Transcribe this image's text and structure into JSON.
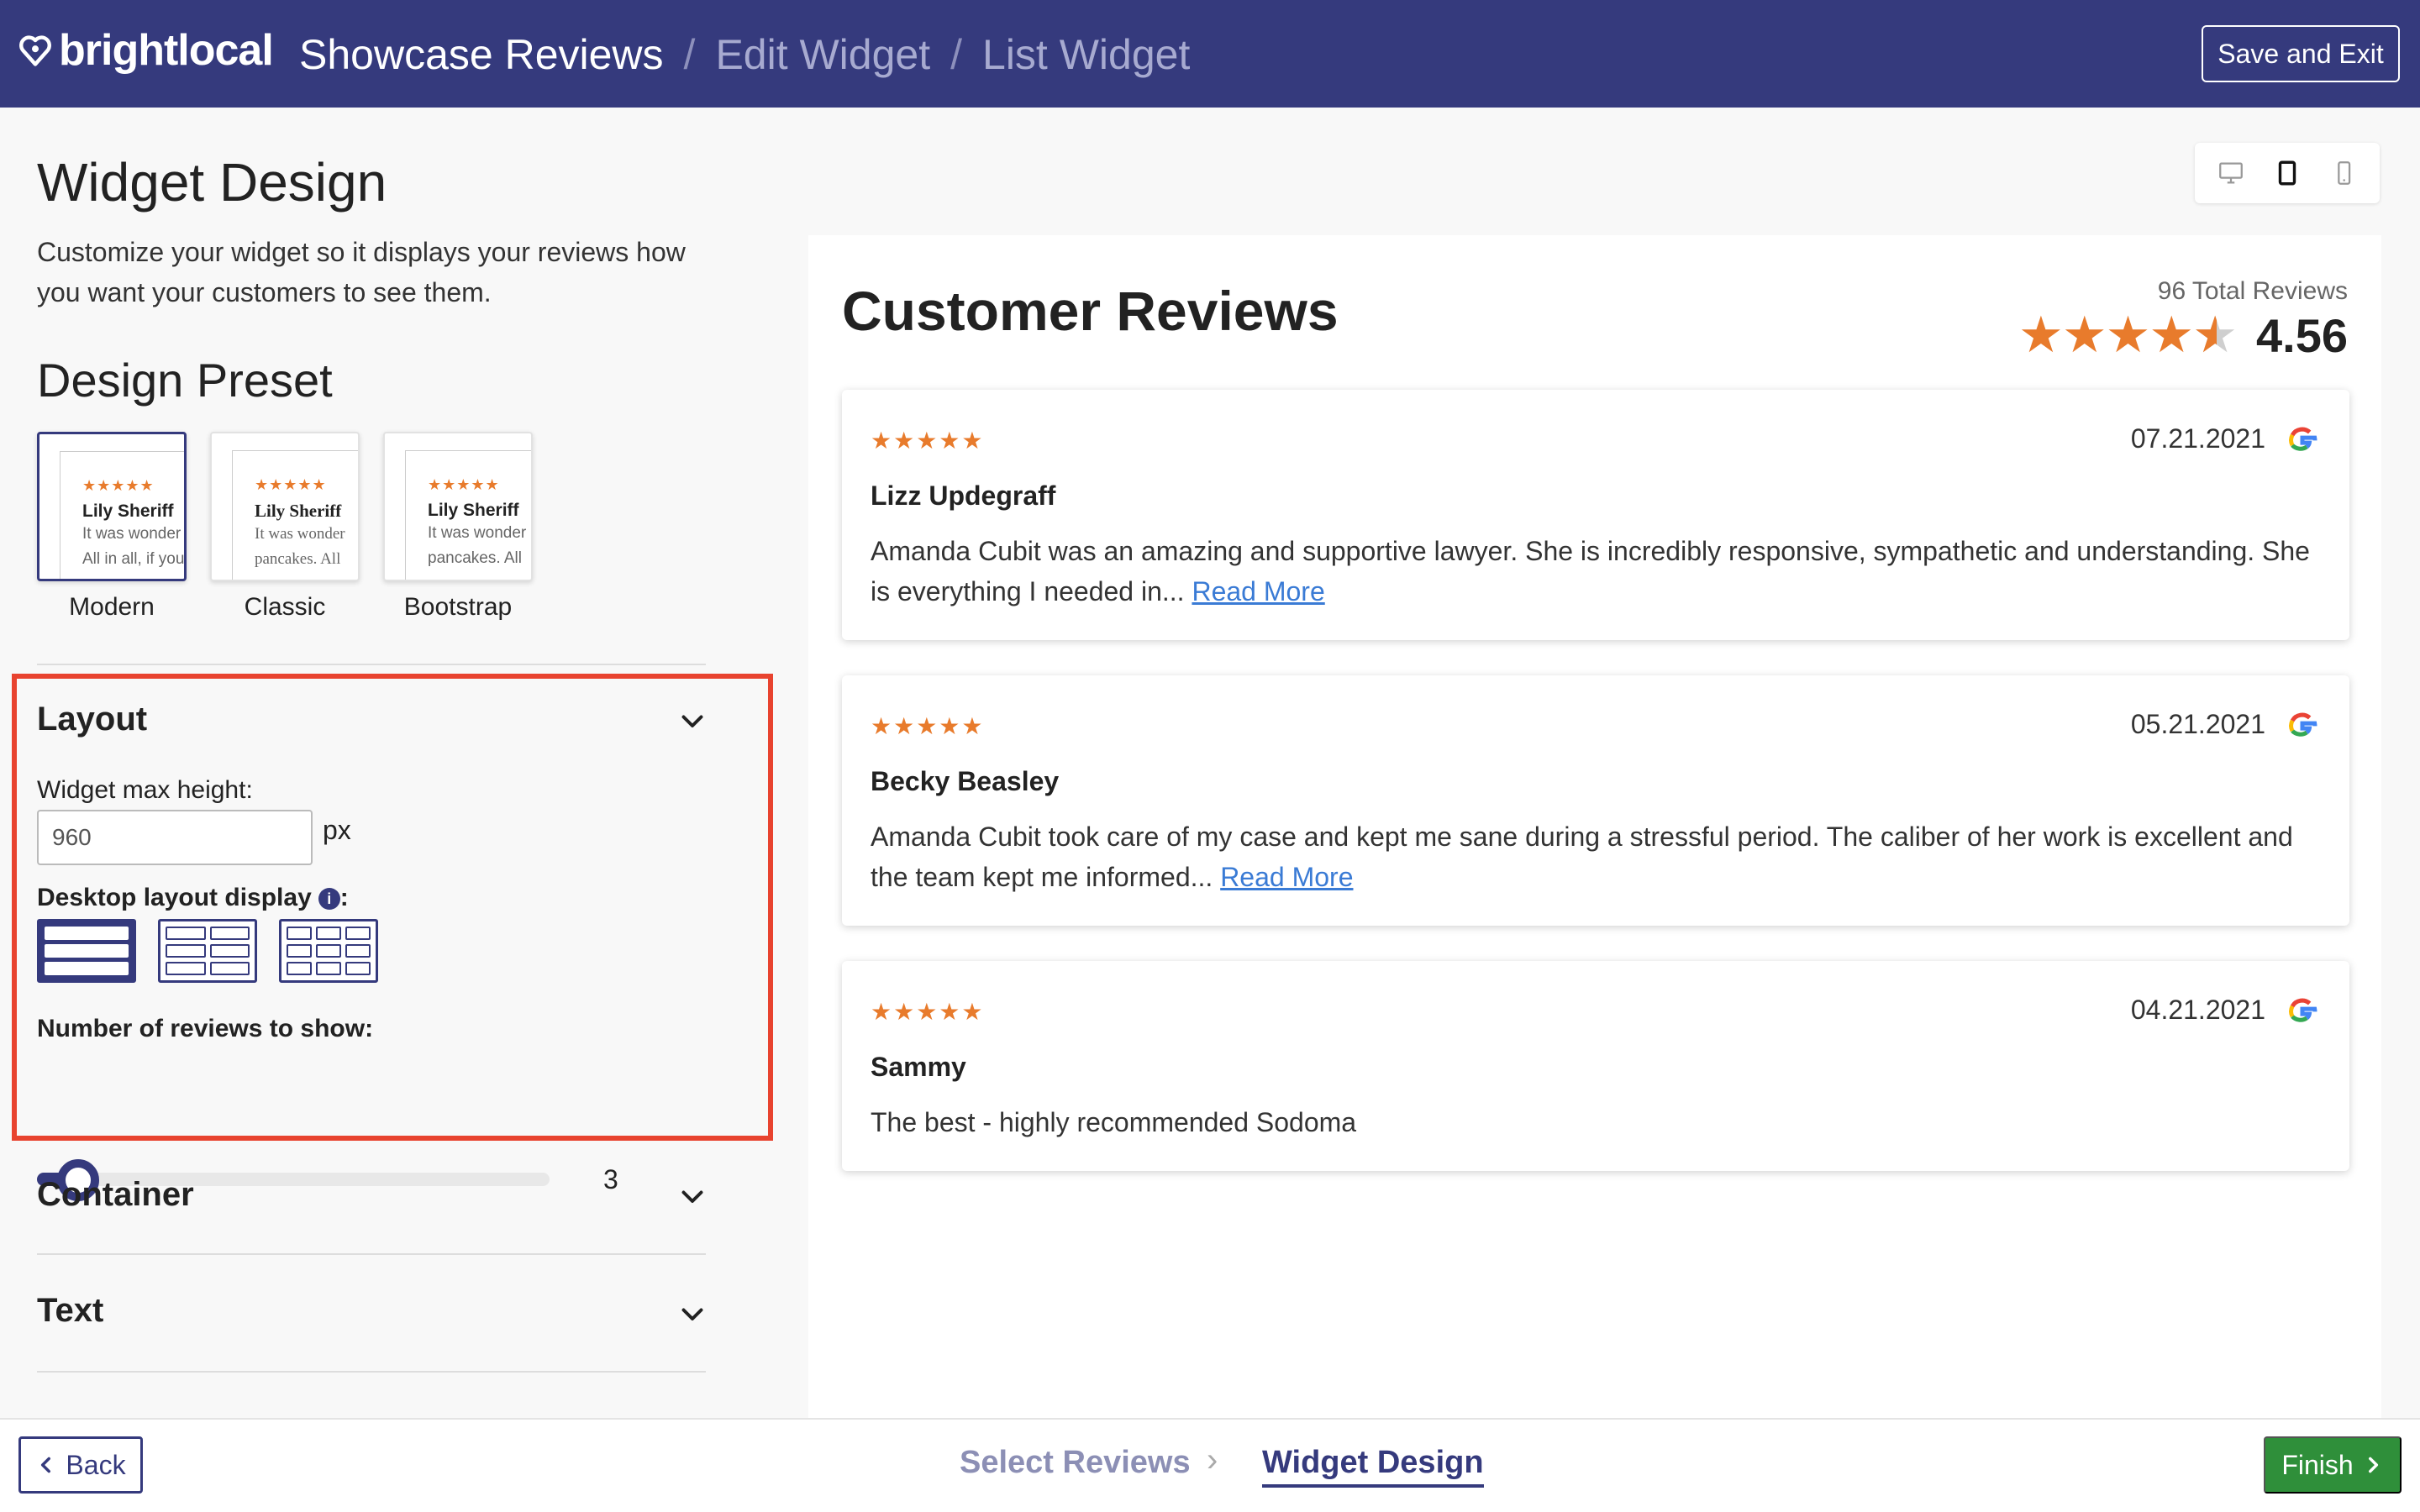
{
  "header": {
    "logo_text": "brightlocal",
    "crumb_1": "Showcase Reviews",
    "crumb_2": "Edit Widget",
    "crumb_3": "List Widget",
    "separator": "/",
    "save_exit": "Save and Exit"
  },
  "left": {
    "title": "Widget Design",
    "subtitle": "Customize your widget so it displays your reviews how you want your customers to see them.",
    "preset_title": "Design Preset",
    "presets": [
      {
        "label": "Modern",
        "name": "Lily Sheriff",
        "line1": "It was wonder",
        "line2": "All in all, if you",
        "stars": "★★★★★"
      },
      {
        "label": "Classic",
        "name": "Lily Sheriff",
        "line1": "It was wonder",
        "line2": "pancakes. All",
        "stars": "★★★★★"
      },
      {
        "label": "Bootstrap",
        "name": "Lily Sheriff",
        "line1": "It was wonder",
        "line2": "pancakes. All",
        "stars": "★★★★★"
      }
    ],
    "selected_preset": "Modern",
    "layout": {
      "title": "Layout",
      "max_height_label": "Widget max height:",
      "max_height_value": "960",
      "max_height_unit": "px",
      "desktop_display_label": "Desktop layout display",
      "desktop_display_suffix": ":",
      "info_icon": "i",
      "reviews_label": "Number of reviews to show:",
      "reviews_count": "3",
      "reviews_slider_fraction": 0.05
    },
    "container_title": "Container",
    "text_title": "Text"
  },
  "preview": {
    "title": "Customer Reviews",
    "total": "96 Total Reviews",
    "score": "4.56",
    "big_stars": "★★★★",
    "reviews": [
      {
        "stars": "★★★★★",
        "date": "07.21.2021",
        "author": "Lizz Updegraff",
        "text": "Amanda Cubit was an amazing and supportive lawyer. She is incredibly responsive, sympathetic and understanding. She is everything I needed in...",
        "more": "Read More"
      },
      {
        "stars": "★★★★★",
        "date": "05.21.2021",
        "author": "Becky Beasley",
        "text": "Amanda Cubit took care of my case and kept me sane during a stressful period. The caliber of her work is excellent and the team kept me informed...",
        "more": "Read More"
      },
      {
        "stars": "★★★★★",
        "date": "04.21.2021",
        "author": "Sammy",
        "text": "The best - highly recommended Sodoma",
        "more": ""
      }
    ]
  },
  "footer": {
    "back": "Back",
    "step_1": "Select Reviews",
    "step_sep": "›",
    "step_2": "Widget Design",
    "finish": "Finish"
  },
  "colors": {
    "brand": "#353a7d",
    "star": "#e87b2c",
    "finish": "#2f8f3a",
    "highlight": "#e8432f",
    "link": "#3a7bd5"
  }
}
